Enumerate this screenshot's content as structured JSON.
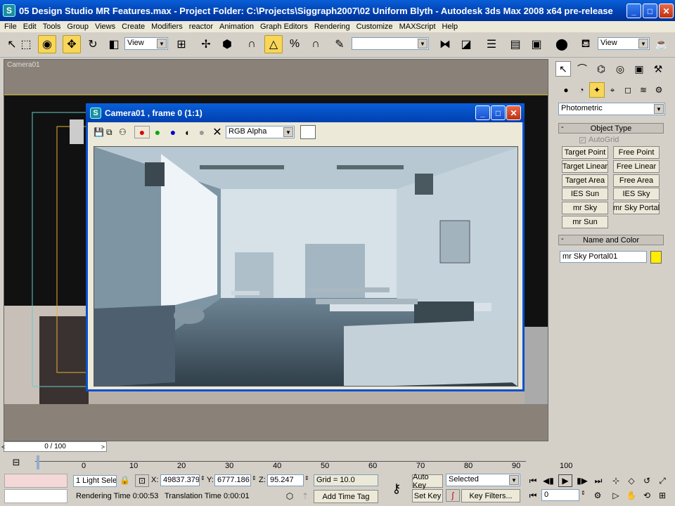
{
  "window": {
    "title": "05 Design Studio MR Features.max - Project Folder: C:\\Projects\\Siggraph2007\\02 Uniform Blyth - Autodesk 3ds Max 2008 x64 pre-release",
    "icon_label": "S"
  },
  "menu": [
    "File",
    "Edit",
    "Tools",
    "Group",
    "Views",
    "Create",
    "Modifiers",
    "reactor",
    "Animation",
    "Graph Editors",
    "Rendering",
    "Customize",
    "MAXScript",
    "Help"
  ],
  "toolbar": {
    "ref_coord": "View",
    "named_selection": "",
    "ref_coord_right": "View"
  },
  "viewport": {
    "label": "Camera01"
  },
  "render_window": {
    "title": "Camera01 , frame 0 (1:1)",
    "channel": "RGB Alpha"
  },
  "command_panel": {
    "category": "Photometric",
    "object_type_header": "Object Type",
    "autogrid": "AutoGrid",
    "buttons": [
      "Target Point",
      "Free Point",
      "Target Linear",
      "Free Linear",
      "Target Area",
      "Free Area",
      "IES Sun",
      "IES Sky",
      "mr Sky",
      "mr Sky Portal",
      "mr Sun"
    ],
    "name_color_header": "Name and Color",
    "object_name": "mr Sky Portal01",
    "object_color": "#ffee00"
  },
  "timeline": {
    "frame_display": "0 / 100",
    "ticks": [
      "0",
      "10",
      "20",
      "30",
      "40",
      "50",
      "60",
      "70",
      "80",
      "90",
      "100"
    ]
  },
  "status": {
    "selection": "1 Light Sele",
    "x_label": "X:",
    "x_value": "49837.379",
    "y_label": "Y:",
    "y_value": "6777.186",
    "z_label": "Z:",
    "z_value": "95.247",
    "grid": "Grid = 10.0",
    "rendering_time": "Rendering Time  0:00:53",
    "translation_time": "Translation Time  0:00:01",
    "add_time_tag": "Add Time Tag",
    "auto_key": "Auto Key",
    "set_key": "Set Key",
    "key_mode": "Selected",
    "key_filters": "Key Filters...",
    "current_frame": "0"
  }
}
